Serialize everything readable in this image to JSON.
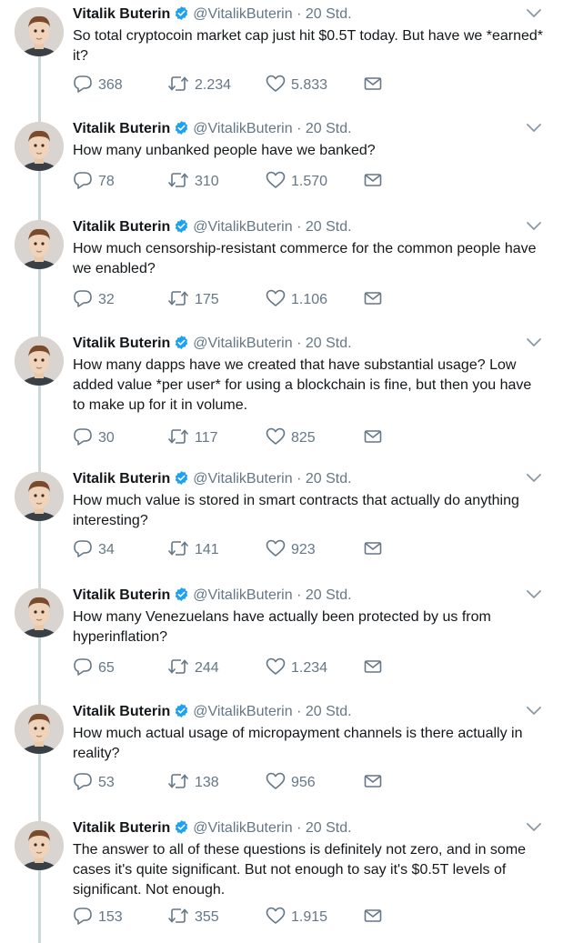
{
  "colors": {
    "text": "#14171a",
    "muted": "#657786",
    "verified": "#1da1f2",
    "thread_line": "#ccd6dd"
  },
  "icons": {
    "reply": "speech-bubble-icon",
    "retweet": "retweet-arrows-icon",
    "like": "heart-icon",
    "dm": "envelope-icon",
    "verified": "verified-badge-icon",
    "more": "chevron-down-icon"
  },
  "tweets": [
    {
      "name": "Vitalik Buterin",
      "handle": "@VitalikButerin",
      "sep": "·",
      "time": "20 Std.",
      "text": "So total cryptocoin market cap just hit $0.5T today. But have we *earned* it?",
      "replies": "368",
      "retweets": "2.234",
      "likes": "5.833"
    },
    {
      "name": "Vitalik Buterin",
      "handle": "@VitalikButerin",
      "sep": "·",
      "time": "20 Std.",
      "text": "How many unbanked people have we banked?",
      "replies": "78",
      "retweets": "310",
      "likes": "1.570"
    },
    {
      "name": "Vitalik Buterin",
      "handle": "@VitalikButerin",
      "sep": "·",
      "time": "20 Std.",
      "text": "How much censorship-resistant commerce for the common people have we enabled?",
      "replies": "32",
      "retweets": "175",
      "likes": "1.106"
    },
    {
      "name": "Vitalik Buterin",
      "handle": "@VitalikButerin",
      "sep": "·",
      "time": "20 Std.",
      "text": "How many dapps have we created that have substantial usage? Low added value *per user* for using a blockchain is fine, but then you have to make up for it in volume.",
      "replies": "30",
      "retweets": "117",
      "likes": "825"
    },
    {
      "name": "Vitalik Buterin",
      "handle": "@VitalikButerin",
      "sep": "·",
      "time": "20 Std.",
      "text": "How much value is stored in smart contracts that actually do anything interesting?",
      "replies": "34",
      "retweets": "141",
      "likes": "923"
    },
    {
      "name": "Vitalik Buterin",
      "handle": "@VitalikButerin",
      "sep": "·",
      "time": "20 Std.",
      "text": "How many Venezuelans have actually been protected by us from hyperinflation?",
      "replies": "65",
      "retweets": "244",
      "likes": "1.234"
    },
    {
      "name": "Vitalik Buterin",
      "handle": "@VitalikButerin",
      "sep": "·",
      "time": "20 Std.",
      "text": "How much actual usage of micropayment channels is there actually in reality?",
      "replies": "53",
      "retweets": "138",
      "likes": "956"
    },
    {
      "name": "Vitalik Buterin",
      "handle": "@VitalikButerin",
      "sep": "·",
      "time": "20 Std.",
      "text": "The answer to all of these questions is definitely not zero, and in some cases it's quite significant. But not enough to say it's $0.5T levels of significant. Not enough.",
      "replies": "153",
      "retweets": "355",
      "likes": "1.915"
    }
  ]
}
